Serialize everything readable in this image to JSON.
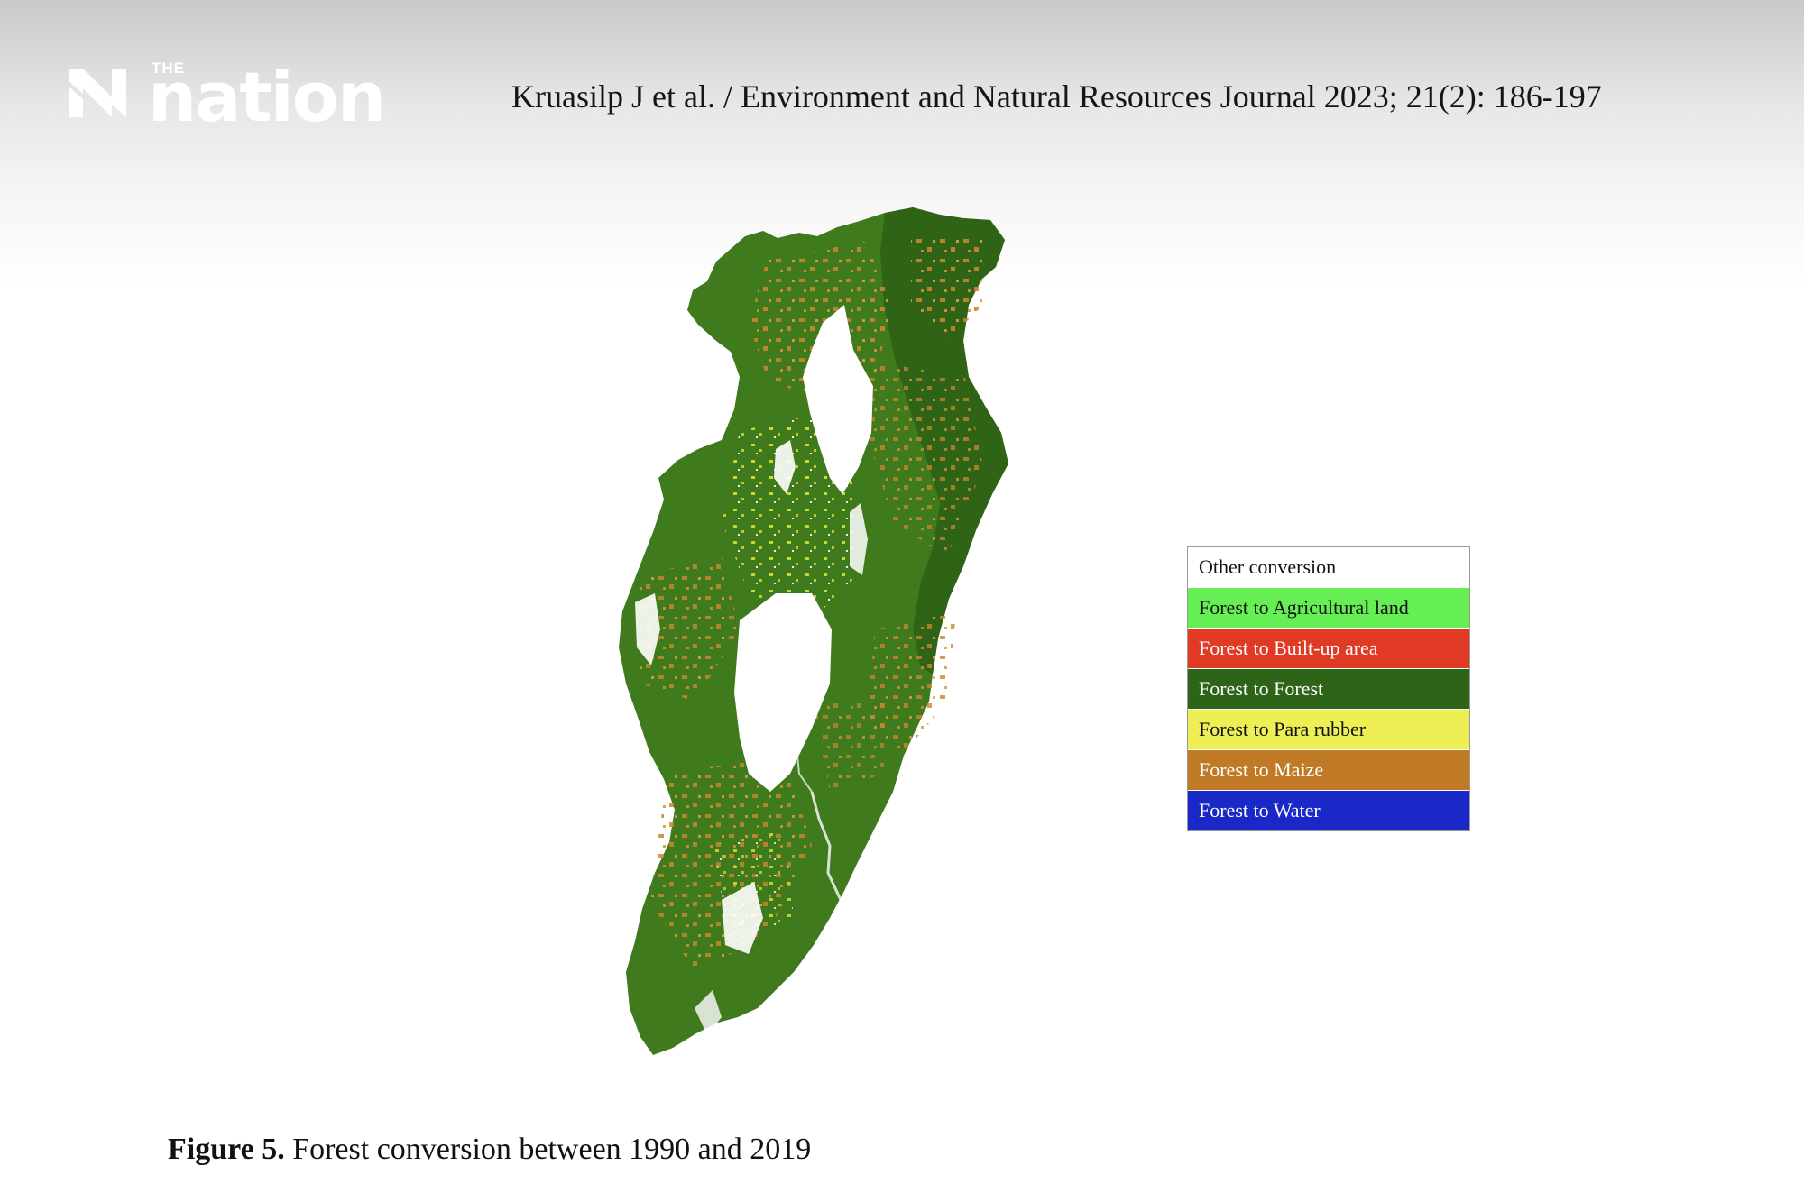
{
  "brand": {
    "the": "THE",
    "name": "nation"
  },
  "citation": "Kruasilp J et al. / Environment and Natural Resources Journal 2023; 21(2): 186-197",
  "map": {
    "icon": "region-map",
    "colors": {
      "forest": "#3f7a1d",
      "forest_dark": "#2f6316",
      "maize": "#c8872e",
      "para_rubber": "#dde23a",
      "other": "#ffffff"
    }
  },
  "legend": {
    "items": [
      {
        "label": "Other conversion",
        "color": "#ffffff",
        "text_color": "#111111"
      },
      {
        "label": "Forest to Agricultural land",
        "color": "#66ee55",
        "text_color": "#111111"
      },
      {
        "label": "Forest to Built-up area",
        "color": "#e03a24",
        "text_color": "#ffffff"
      },
      {
        "label": "Forest to Forest",
        "color": "#2d6417",
        "text_color": "#ffffff"
      },
      {
        "label": "Forest to Para rubber",
        "color": "#eeee55",
        "text_color": "#111111"
      },
      {
        "label": "Forest to Maize",
        "color": "#c07a25",
        "text_color": "#ffffff"
      },
      {
        "label": "Forest to Water",
        "color": "#1a28c8",
        "text_color": "#ffffff"
      }
    ]
  },
  "caption": {
    "label": "Figure 5.",
    "text": " Forest conversion between 1990 and 2019"
  }
}
